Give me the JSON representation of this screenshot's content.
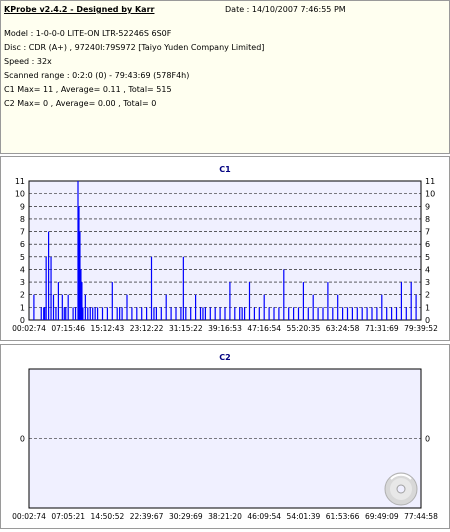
{
  "header": {
    "app_title": "KProbe v2.4.2 - Designed by Karr",
    "date": "Date : 14/10/2007 7:46:55 PM",
    "model": "Model : 1-0-0-0 LITE-ON LTR-52246S      6S0F",
    "disc": "Disc : CDR (A+) , 97240I:79S972 [Taiyo Yuden Company Limited]",
    "speed": "Speed : 32x",
    "scanned_range": "Scanned range : 0:2:0 (0) - 79:43:69 (578F4h)",
    "c1_summary": "C1 Max= 11 , Average= 0.11 , Total= 515",
    "c2_summary": "C2 Max= 0 , Average= 0.00 , Total= 0"
  },
  "colors": {
    "info_background": "#fffff0",
    "plot_background": "#f0f0ff",
    "bar_color": "#0000ff",
    "title_color": "#000080",
    "grid_color": "#000000"
  },
  "chart_data": [
    {
      "type": "bar",
      "title": "C1",
      "ylim": [
        0,
        11
      ],
      "y_ticks": [
        "0",
        "1",
        "2",
        "3",
        "4",
        "5",
        "6",
        "7",
        "8",
        "9",
        "10",
        "11"
      ],
      "right_axis_ticks": true,
      "grid": "dashed-horizontal",
      "x_tick_labels": [
        "00:02:74",
        "07:15:46",
        "15:12:43",
        "23:12:22",
        "31:15:22",
        "39:16:53",
        "47:16:54",
        "55:20:35",
        "63:24:58",
        "71:31:69",
        "79:39:52"
      ],
      "x_range_minutes": [
        0,
        80
      ],
      "x": [
        1,
        2.5,
        3,
        3.2,
        3.5,
        4,
        4.5,
        5,
        5.5,
        6,
        6.8,
        7.2,
        7.5,
        8,
        9,
        9.5,
        10,
        10.2,
        10.4,
        10.6,
        10.8,
        11,
        11.5,
        12,
        12.5,
        13,
        13.5,
        14,
        15,
        16,
        17,
        18,
        18.5,
        19,
        20,
        21,
        22,
        23,
        24,
        25,
        25.5,
        26,
        27,
        28,
        29,
        30,
        31,
        31.5,
        32,
        33,
        34,
        35,
        35.5,
        36,
        37,
        38,
        39,
        40,
        41,
        42,
        43,
        43.5,
        44,
        45,
        46,
        47,
        48,
        49,
        50,
        51,
        52,
        53,
        54,
        55,
        56,
        57,
        58,
        59,
        60,
        61,
        62,
        63,
        64,
        65,
        66,
        67,
        68,
        69,
        70,
        71,
        72,
        73,
        74,
        75,
        76,
        77,
        78,
        79
      ],
      "values": [
        2,
        1,
        1,
        1,
        5,
        7,
        5,
        2,
        1,
        3,
        2,
        1,
        1,
        2,
        1,
        1,
        11,
        9,
        7,
        4,
        3,
        1,
        2,
        1,
        1,
        1,
        1,
        1,
        1,
        1,
        3,
        1,
        1,
        1,
        2,
        1,
        1,
        1,
        1,
        5,
        1,
        1,
        1,
        2,
        1,
        1,
        1,
        5,
        1,
        1,
        2,
        1,
        1,
        1,
        1,
        1,
        1,
        1,
        3,
        1,
        1,
        1,
        1,
        3,
        1,
        1,
        2,
        1,
        1,
        1,
        4,
        1,
        1,
        1,
        3,
        1,
        2,
        1,
        1,
        3,
        1,
        2,
        1,
        1,
        1,
        1,
        1,
        1,
        1,
        1,
        2,
        1,
        1,
        1,
        3,
        1,
        3,
        2
      ]
    },
    {
      "type": "bar",
      "title": "C2",
      "ylim": [
        -1,
        1
      ],
      "y_ticks": [
        "0"
      ],
      "right_axis_ticks": true,
      "grid": "dashed-zero-line",
      "x_tick_labels": [
        "00:02:74",
        "07:05:21",
        "14:50:52",
        "22:39:67",
        "30:29:69",
        "38:21:20",
        "46:09:54",
        "54:01:39",
        "61:53:66",
        "69:49:09",
        "77:44:58"
      ],
      "x_range_minutes": [
        0,
        80
      ],
      "x": [],
      "values": []
    }
  ]
}
